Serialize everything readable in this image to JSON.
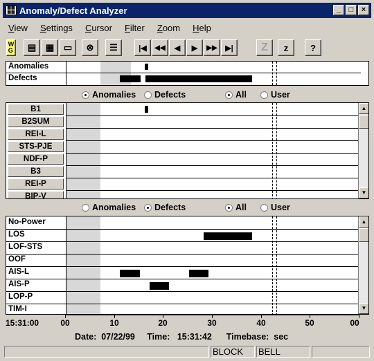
{
  "window": {
    "title": "Anomaly/Defect Analyzer",
    "minimize": "_",
    "maximize": "□",
    "close": "×"
  },
  "menu": [
    "View",
    "Settings",
    "Cursor",
    "Filter",
    "Zoom",
    "Help"
  ],
  "toolbar": {
    "first": "|◀",
    "fast_back": "◀◀",
    "back": "◀",
    "forward": "▶",
    "fast_forward": "▶▶",
    "last": "▶|",
    "zoom_z_disabled": "Z",
    "zoom_z": "z",
    "help": "?"
  },
  "summary": {
    "rows": [
      "Anomalies",
      "Defects"
    ]
  },
  "filter1": {
    "anomalies": "Anomalies",
    "defects": "Defects",
    "all": "All",
    "user": "User",
    "selected_type": "Anomalies",
    "selected_scope": "All"
  },
  "anomaly_rows": [
    "B1",
    "B2SUM",
    "REI-L",
    "STS-PJE",
    "NDF-P",
    "B3",
    "REI-P",
    "BIP-V"
  ],
  "filter2": {
    "anomalies": "Anomalies",
    "defects": "Defects",
    "all": "All",
    "user": "User",
    "selected_type": "Defects",
    "selected_scope": "All"
  },
  "defect_rows": [
    "No-Power",
    "LOS",
    "LOF-STS",
    "OOF",
    "AIS-L",
    "AIS-P",
    "LOP-P",
    "TIM-I"
  ],
  "axis": {
    "start_time": "15:31:00",
    "ticks": [
      "00",
      "10",
      "20",
      "30",
      "40",
      "50",
      "00"
    ]
  },
  "info": {
    "date_label": "Date:",
    "date": "07/22/99",
    "time_label": "Time:",
    "time": "15:31:42",
    "timebase_label": "Timebase:",
    "timebase": "sec"
  },
  "status": {
    "block": "BLOCK",
    "bell": "BELL"
  }
}
